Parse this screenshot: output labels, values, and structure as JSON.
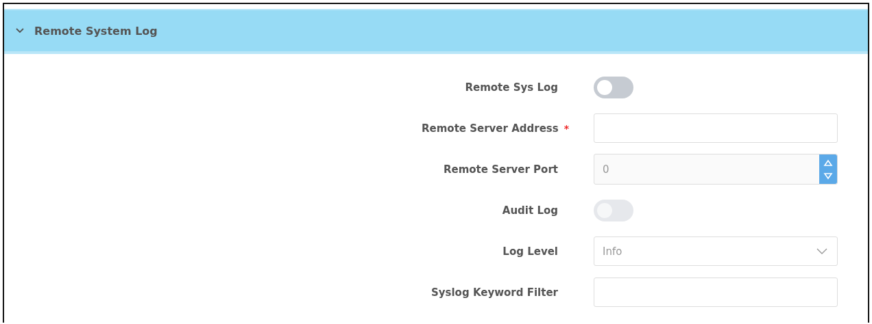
{
  "section": {
    "title": "Remote System Log",
    "expanded": true
  },
  "fields": [
    {
      "kind": "toggle",
      "label": "Remote Sys Log",
      "on": false,
      "disabled": false
    },
    {
      "kind": "text",
      "label": "Remote Server Address",
      "required_mark": "*"
    },
    {
      "kind": "number",
      "label": "Remote Server Port",
      "value": "0"
    },
    {
      "kind": "toggle",
      "label": "Audit Log",
      "on": false,
      "disabled": true
    },
    {
      "kind": "select",
      "label": "Log Level",
      "value": "Info"
    },
    {
      "kind": "text",
      "label": "Syslog Keyword Filter"
    }
  ]
}
